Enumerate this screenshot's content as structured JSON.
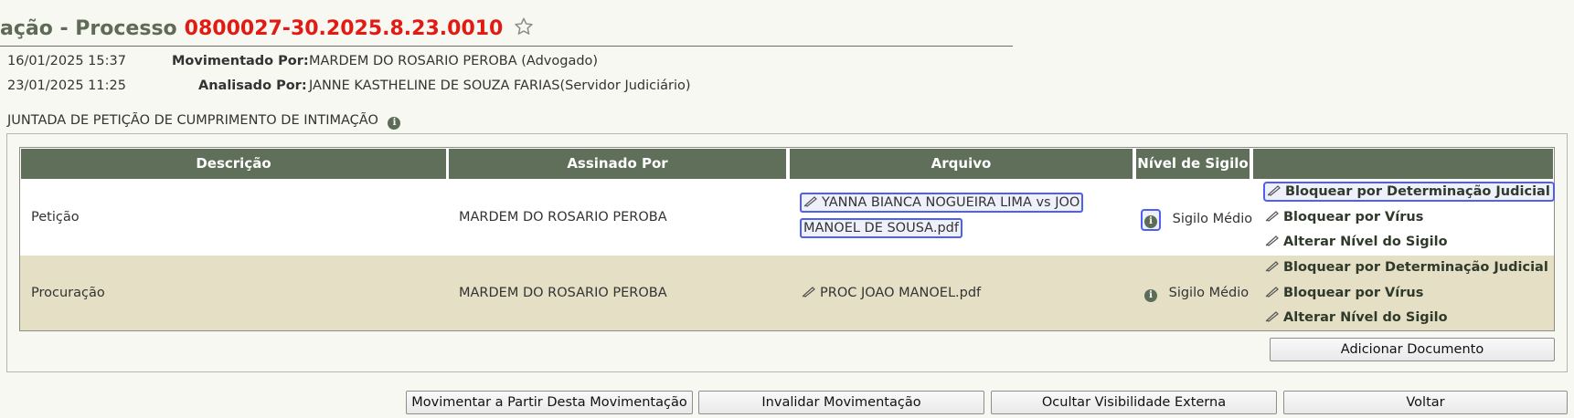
{
  "header": {
    "title_prefix": "ação - Processo",
    "process_number": "0800027-30.2025.8.23.0010"
  },
  "movement": {
    "moved": {
      "date": "16/01/2025 15:37",
      "label": "Movimentado Por:",
      "value": "MARDEM DO ROSARIO PEROBA (Advogado)"
    },
    "analyzed": {
      "date": "23/01/2025 11:25",
      "label": "Analisado Por:",
      "value": "JANNE KASTHELINE DE SOUZA FARIAS(Servidor Judiciário)"
    },
    "description": "JUNTADA DE PETIÇÃO DE CUMPRIMENTO DE INTIMAÇÃO"
  },
  "table": {
    "headers": [
      "Descrição",
      "Assinado Por",
      "Arquivo",
      "Nível de Sigilo",
      ""
    ],
    "rows": [
      {
        "descricao": "Petição",
        "assinado_por": "MARDEM DO ROSARIO PEROBA",
        "arquivo_line1": "YANNA BIANCA NOGUEIRA LIMA vs JOO",
        "arquivo_line2": "MANOEL DE SOUSA.pdf",
        "sigilo": "Sigilo Médio",
        "actions": [
          "Bloquear por Determinação Judicial",
          "Bloquear por Vírus",
          "Alterar Nível do Sigilo"
        ]
      },
      {
        "descricao": "Procuração",
        "assinado_por": "MARDEM DO ROSARIO PEROBA",
        "arquivo_line1": "PROC JOAO MANOEL.pdf",
        "sigilo": "Sigilo Médio",
        "actions": [
          "Bloquear por Determinação Judicial",
          "Bloquear por Vírus",
          "Alterar Nível do Sigilo"
        ]
      }
    ]
  },
  "buttons": {
    "add_document": "Adicionar Documento",
    "move_from": "Movimentar a Partir Desta Movimentação",
    "invalidate": "Invalidar Movimentação",
    "hide_external": "Ocultar Visibilidade Externa",
    "back": "Voltar"
  },
  "icons": {
    "favorite": "star-outline-icon",
    "info": "info-icon",
    "edit": "pencil-icon"
  },
  "colors": {
    "header_bg": "#5f6f5a",
    "process_number": "#e11b14",
    "row_alt": "#e5dfc6",
    "focus": "#4e5ff1"
  }
}
